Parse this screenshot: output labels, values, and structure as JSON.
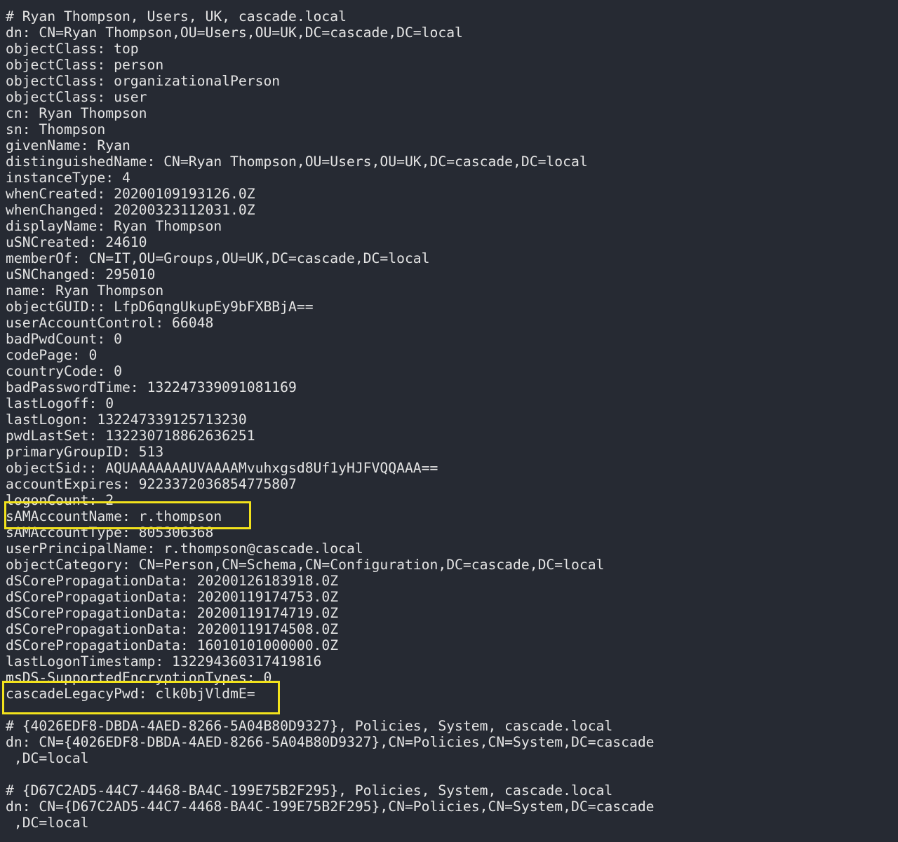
{
  "terminal": {
    "lines": [
      "# Ryan Thompson, Users, UK, cascade.local",
      "dn: CN=Ryan Thompson,OU=Users,OU=UK,DC=cascade,DC=local",
      "objectClass: top",
      "objectClass: person",
      "objectClass: organizationalPerson",
      "objectClass: user",
      "cn: Ryan Thompson",
      "sn: Thompson",
      "givenName: Ryan",
      "distinguishedName: CN=Ryan Thompson,OU=Users,OU=UK,DC=cascade,DC=local",
      "instanceType: 4",
      "whenCreated: 20200109193126.0Z",
      "whenChanged: 20200323112031.0Z",
      "displayName: Ryan Thompson",
      "uSNCreated: 24610",
      "memberOf: CN=IT,OU=Groups,OU=UK,DC=cascade,DC=local",
      "uSNChanged: 295010",
      "name: Ryan Thompson",
      "objectGUID:: LfpD6qngUkupEy9bFXBBjA==",
      "userAccountControl: 66048",
      "badPwdCount: 0",
      "codePage: 0",
      "countryCode: 0",
      "badPasswordTime: 132247339091081169",
      "lastLogoff: 0",
      "lastLogon: 132247339125713230",
      "pwdLastSet: 132230718862636251",
      "primaryGroupID: 513",
      "objectSid:: AQUAAAAAAAUVAAAAMvuhxgsd8Uf1yHJFVQQAAA==",
      "accountExpires: 9223372036854775807",
      "logonCount: 2",
      "sAMAccountName: r.thompson",
      "sAMAccountType: 805306368",
      "userPrincipalName: r.thompson@cascade.local",
      "objectCategory: CN=Person,CN=Schema,CN=Configuration,DC=cascade,DC=local",
      "dSCorePropagationData: 20200126183918.0Z",
      "dSCorePropagationData: 20200119174753.0Z",
      "dSCorePropagationData: 20200119174719.0Z",
      "dSCorePropagationData: 20200119174508.0Z",
      "dSCorePropagationData: 16010101000000.0Z",
      "lastLogonTimestamp: 132294360317419816",
      "msDS-SupportedEncryptionTypes: 0",
      "cascadeLegacyPwd: clk0bjVldmE=",
      "",
      "# {4026EDF8-DBDA-4AED-8266-5A04B80D9327}, Policies, System, cascade.local",
      "dn: CN={4026EDF8-DBDA-4AED-8266-5A04B80D9327},CN=Policies,CN=System,DC=cascade",
      " ,DC=local",
      "",
      "# {D67C2AD5-44C7-4468-BA4C-199E75B2F295}, Policies, System, cascade.local",
      "dn: CN={D67C2AD5-44C7-4468-BA4C-199E75B2F295},CN=Policies,CN=System,DC=cascade",
      " ,DC=local"
    ],
    "highlighted_lines": [
      31,
      42
    ],
    "colors": {
      "background": "#262a33",
      "text": "#e4e4e4",
      "highlight": "#f2e21c"
    }
  }
}
